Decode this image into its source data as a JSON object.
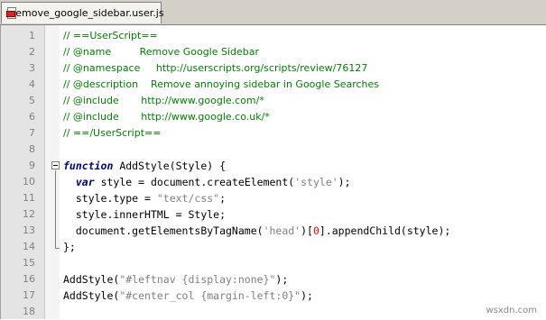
{
  "tab": {
    "title": "remove_google_sidebar.user.js",
    "icon": "script-file-icon"
  },
  "lines": [
    {
      "n": "1",
      "text": "// ==UserScript=="
    },
    {
      "n": "2",
      "text": "// @name         Remove Google Sidebar"
    },
    {
      "n": "3",
      "text": "// @namespace     http://userscripts.org/scripts/review/76127"
    },
    {
      "n": "4",
      "text": "// @description    Remove annoying sidebar in Google Searches"
    },
    {
      "n": "5",
      "text": "// @include       http://www.google.com/*"
    },
    {
      "n": "6",
      "text": "// @include       http://www.google.co.uk/*"
    },
    {
      "n": "7",
      "text": "// ==/UserScript=="
    },
    {
      "n": "8",
      "text": ""
    },
    {
      "n": "9",
      "kw": "function",
      "rest": " AddStyle(Style) {"
    },
    {
      "n": "10",
      "indent": "  ",
      "kw": "var",
      "rest": " style = document.createElement(",
      "str": "'style'",
      "tail": ");"
    },
    {
      "n": "11",
      "text": "  style.type = ",
      "str": "\"text/css\"",
      "tail": ";"
    },
    {
      "n": "12",
      "text": "  style.innerHTML = Style;"
    },
    {
      "n": "13",
      "text": "  document.getElementsByTagName(",
      "str": "'head'",
      "mid": ")[",
      "num": "0",
      "tail": "].appendChild(style);"
    },
    {
      "n": "14",
      "text": "};"
    },
    {
      "n": "15",
      "text": ""
    },
    {
      "n": "16",
      "text": "AddStyle(",
      "str": "\"#leftnav {display:none}\"",
      "tail": ");"
    },
    {
      "n": "17",
      "text": "AddStyle(",
      "str": "\"#center_col {margin-left:0}\"",
      "tail": ");"
    },
    {
      "n": "18",
      "text": ""
    }
  ],
  "watermark": "wsxdn.com",
  "colors": {
    "comment": "#008000",
    "keyword": "#000080",
    "string": "#808080",
    "number": "#ff0000"
  }
}
